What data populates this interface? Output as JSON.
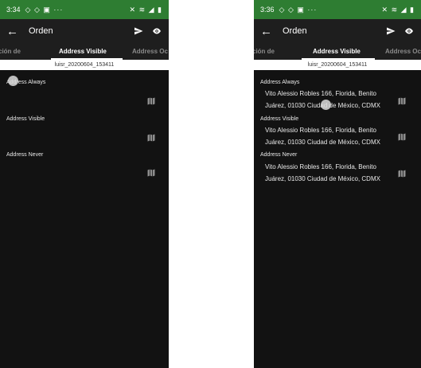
{
  "screens": [
    {
      "status": {
        "time": "3:34",
        "left_icons": "◇ ◇ ▣ ···",
        "right_icons": "✕ ≋ ◢ ▮"
      },
      "appbar": {
        "back": "←",
        "title": "Orden"
      },
      "tabs": [
        {
          "label": "ción de"
        },
        {
          "label": "Address Visible"
        },
        {
          "label": "Address Oc"
        }
      ],
      "order_id": "luisr_20200604_153411",
      "sections": [
        {
          "label": "Address Always",
          "address_line1": "",
          "address_line2": "",
          "icon": "map-icon"
        },
        {
          "label": "Address Visible",
          "address_line1": "",
          "address_line2": "",
          "icon": "map-icon"
        },
        {
          "label": "Address Never",
          "address_line1": "",
          "address_line2": "",
          "icon": "map-icon"
        }
      ]
    },
    {
      "status": {
        "time": "3:36",
        "left_icons": "◇ ◇ ▣ ···",
        "right_icons": "✕ ≋ ◢ ▮"
      },
      "appbar": {
        "back": "←",
        "title": "Orden"
      },
      "tabs": [
        {
          "label": "ción de"
        },
        {
          "label": "Address Visible"
        },
        {
          "label": "Address Oc"
        }
      ],
      "order_id": "luisr_20200604_153411",
      "sections": [
        {
          "label": "Address Always",
          "address_line1": "Vito Alessio Robles 166, Florida, Benito",
          "address_line2": "Juárez, 01030 Ciudad de México, CDMX",
          "icon": "map-icon"
        },
        {
          "label": "Address Visible",
          "address_line1": "Vito Alessio Robles 166, Florida, Benito",
          "address_line2": "Juárez, 01030 Ciudad de México, CDMX",
          "icon": "map-icon"
        },
        {
          "label": "Address Never",
          "address_line1": "Vito Alessio Robles 166, Florida, Benito",
          "address_line2": "Juárez, 01030 Ciudad de México, CDMX",
          "icon": "map-icon"
        }
      ]
    }
  ],
  "colors": {
    "status_bar": "#2e7d32",
    "app_bar": "#1e1e1e",
    "content_bg": "#121212",
    "text": "#e8e8e8",
    "inactive_tab": "#8a8a8a"
  }
}
